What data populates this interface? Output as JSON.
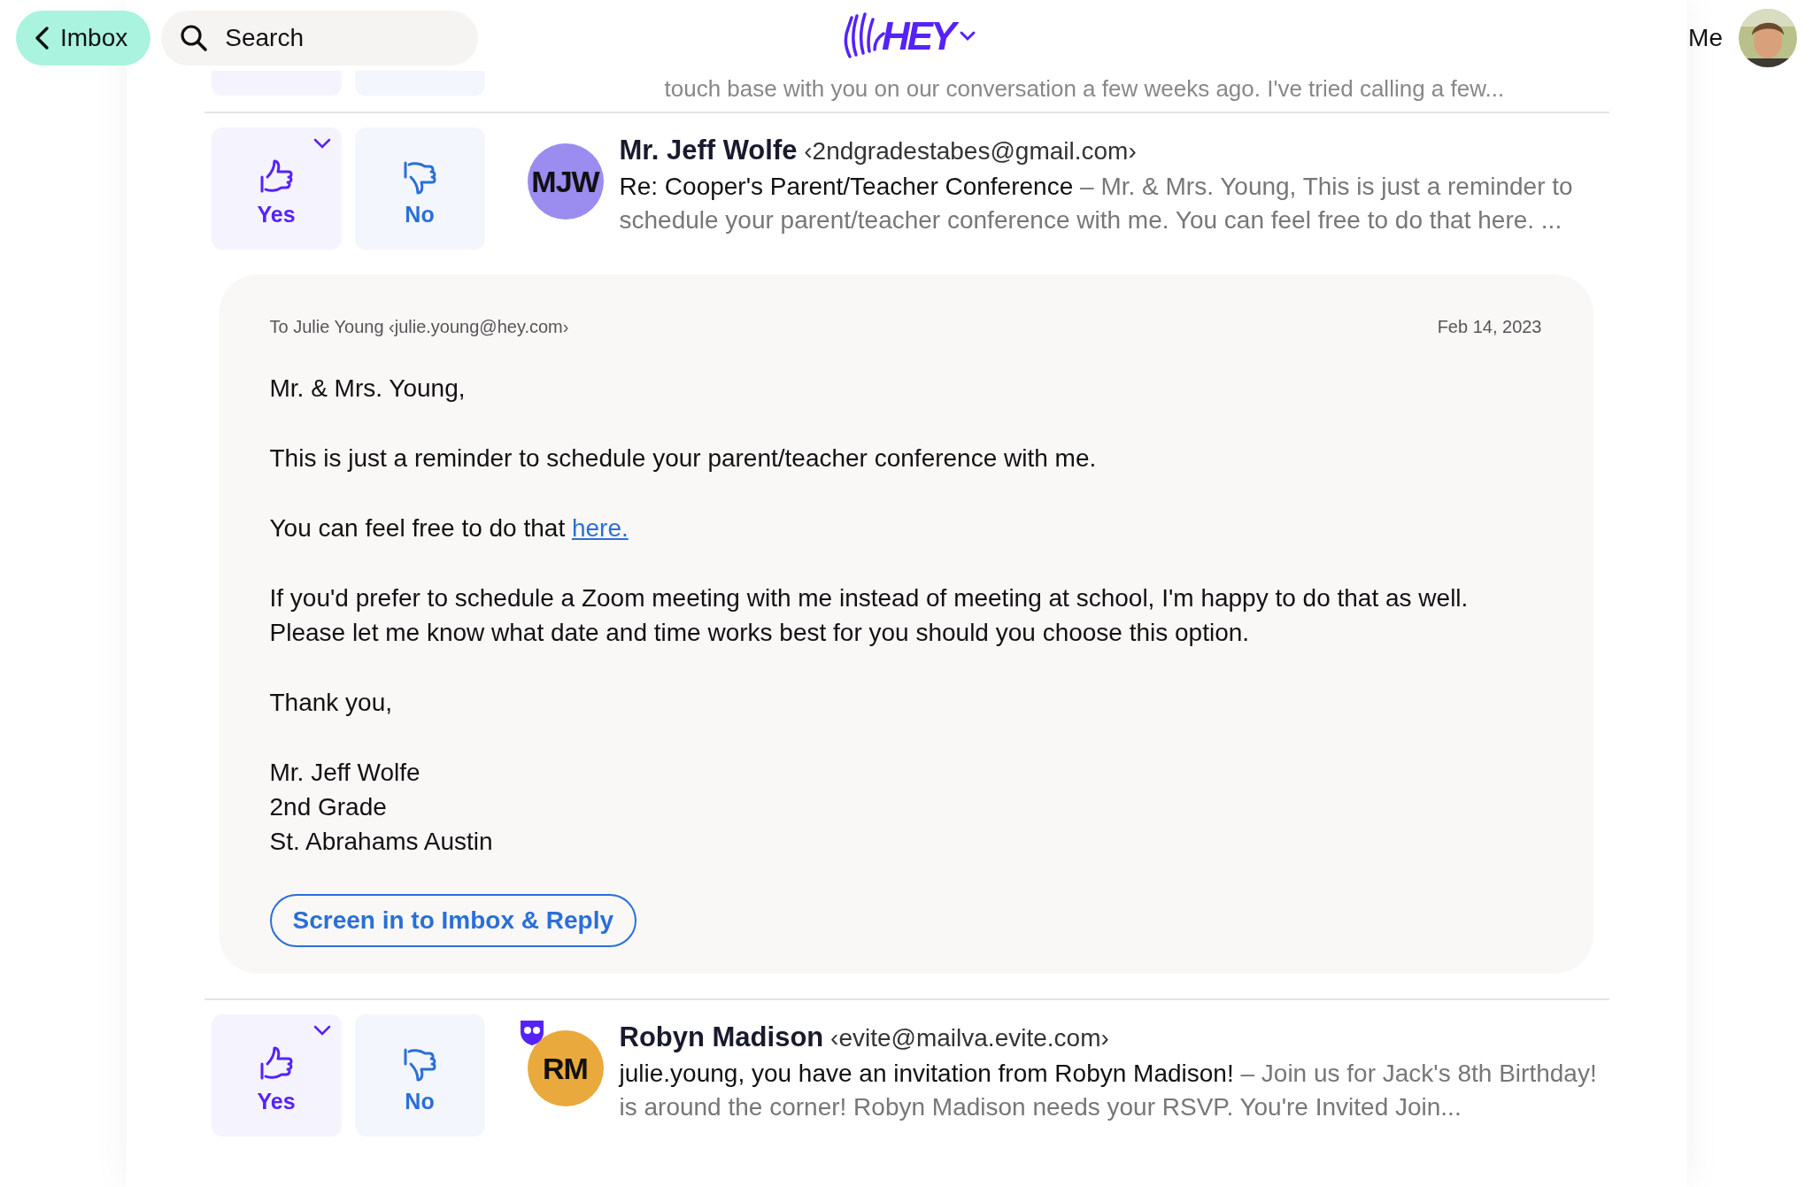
{
  "header": {
    "back_button": "Imbox",
    "search": {
      "placeholder": "Search"
    },
    "logo": "HEY",
    "user_label": "Me"
  },
  "rows": [
    {
      "kind": "faded",
      "preview": "touch base with you on our conversation a few weeks ago. I've tried calling a few..."
    },
    {
      "kind": "full",
      "yes_label": "Yes",
      "no_label": "No",
      "initials": "MJW",
      "color": "#9b8cf0",
      "badge": false,
      "sender": "Mr. Jeff Wolfe",
      "email": "‹2ndgradestabes@gmail.com›",
      "subject": "Re: Cooper's Parent/Teacher Conference",
      "preview": "– Mr. & Mrs. Young, This is just a reminder to schedule your parent/teacher conference with me. You can feel free to do that here. ...",
      "message": {
        "to": "To Julie Young ‹julie.young@hey.com›",
        "date": "Feb 14, 2023",
        "paragraphs": [
          {
            "text": "Mr. & Mrs. Young,"
          },
          {
            "text": "This is just a reminder to schedule your parent/teacher conference with me."
          },
          {
            "text": "You can feel free to do that ",
            "link": "here."
          },
          {
            "text": "If you'd prefer to schedule a Zoom meeting with me instead of meeting at school, I'm happy to do that as well. Please let me know what date and time works best for you should you choose this option."
          },
          {
            "text": "Thank you,"
          }
        ],
        "signature": [
          "Mr. Jeff Wolfe",
          "2nd Grade",
          "St. Abrahams Austin"
        ],
        "action": "Screen in to Imbox & Reply"
      }
    },
    {
      "kind": "full",
      "yes_label": "Yes",
      "no_label": "No",
      "initials": "RM",
      "color": "#e9a93c",
      "badge": true,
      "sender": "Robyn Madison",
      "email": "‹evite@mailva.evite.com›",
      "subject": "julie.young, you have an invitation from Robyn Madison!",
      "preview": "– Join us for Jack's 8th Birthday! is around the corner! Robyn Madison needs your RSVP. You're Invited Join..."
    }
  ]
}
